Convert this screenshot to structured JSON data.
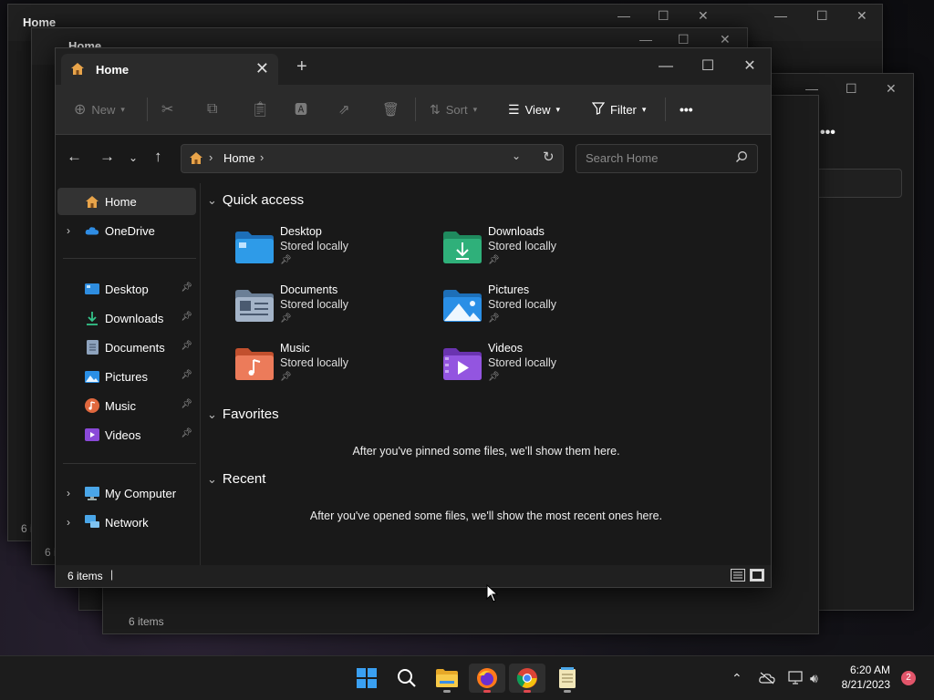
{
  "window": {
    "tab_title": "Home",
    "close_tab": "✕",
    "new_tab": "+",
    "minimize": "—",
    "maximize": "☐",
    "close": "✕"
  },
  "toolbar": {
    "new_label": "New",
    "sort_label": "Sort",
    "view_label": "View",
    "filter_label": "Filter",
    "more_label": "•••"
  },
  "address": {
    "crumb": "Home",
    "search_placeholder": "Search Home"
  },
  "sidebar": {
    "home": "Home",
    "onedrive": "OneDrive",
    "pinned": [
      {
        "label": "Desktop",
        "icon": "desktop-icon"
      },
      {
        "label": "Downloads",
        "icon": "download-icon"
      },
      {
        "label": "Documents",
        "icon": "documents-icon"
      },
      {
        "label": "Pictures",
        "icon": "pictures-icon"
      },
      {
        "label": "Music",
        "icon": "music-icon"
      },
      {
        "label": "Videos",
        "icon": "videos-icon"
      }
    ],
    "my_computer": "My Computer",
    "network": "Network"
  },
  "quick_access": {
    "heading": "Quick access",
    "items": [
      {
        "name": "Desktop",
        "sub": "Stored locally"
      },
      {
        "name": "Downloads",
        "sub": "Stored locally"
      },
      {
        "name": "Documents",
        "sub": "Stored locally"
      },
      {
        "name": "Pictures",
        "sub": "Stored locally"
      },
      {
        "name": "Music",
        "sub": "Stored locally"
      },
      {
        "name": "Videos",
        "sub": "Stored locally"
      }
    ]
  },
  "favorites": {
    "heading": "Favorites",
    "empty": "After you've pinned some files, we'll show them here."
  },
  "recent": {
    "heading": "Recent",
    "empty": "After you've opened some files, we'll show the most recent ones here."
  },
  "status": {
    "count": "6 items"
  },
  "background_windows": {
    "tab_title": "Home",
    "count": "6 items"
  },
  "taskbar": {
    "time": "6:20 AM",
    "date": "8/21/2023",
    "notifications": "2"
  },
  "colors": {
    "accent_home": "#e8a44a",
    "folder_blue": "#2e8de0",
    "folder_green": "#2fb07a",
    "folder_music": "#e0683e",
    "folder_video": "#8a49d8",
    "badge": "#e2556a"
  }
}
